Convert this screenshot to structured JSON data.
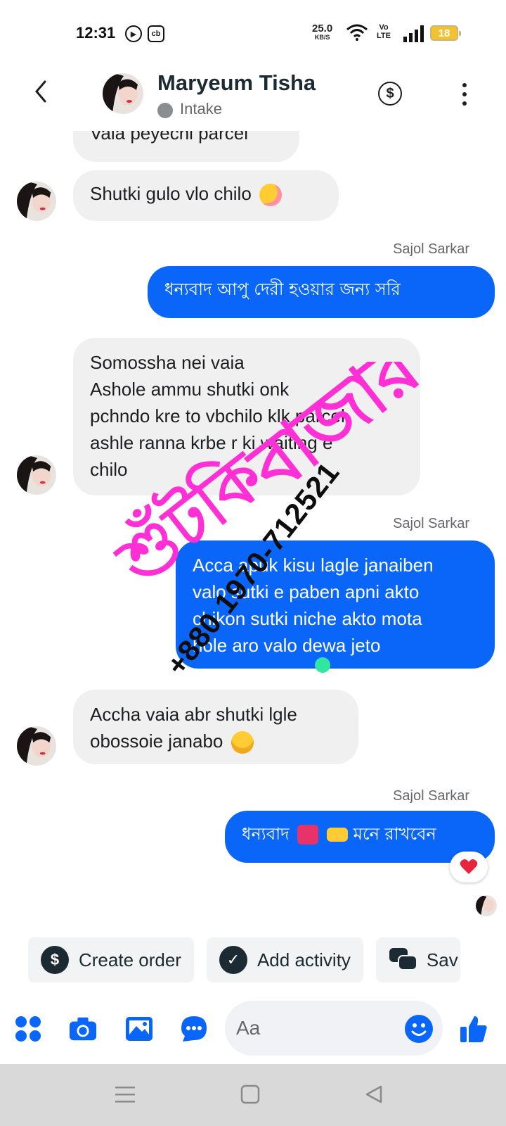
{
  "status_bar": {
    "time": "12:31",
    "net_speed": "25.0",
    "net_unit": "KB/S",
    "volte_top": "Vo",
    "volte_bottom": "LTE",
    "battery": "18"
  },
  "header": {
    "name": "Maryeum Tisha",
    "status": "Intake",
    "dollar_symbol": "$"
  },
  "messages": [
    {
      "from": "contact",
      "text": "Vaia peyechi parcel"
    },
    {
      "from": "contact",
      "text": "Shutki gulo vlo chilo",
      "emoji": "smiling-face-with-hearts"
    },
    {
      "from": "me",
      "sender": "Sajol Sarkar",
      "text": "ধন্যবাদ আপু দেরী হওয়ার জন্য সরি"
    },
    {
      "from": "contact",
      "lines": [
        "Somossha nei vaia",
        "Ashole ammu shutki onk",
        "pchndo kre to vbchilo klk parcel",
        "ashle ranna krbe r ki waiting e",
        "chilo"
      ]
    },
    {
      "from": "me",
      "sender": "Sajol Sarkar",
      "lines": [
        "Acca apuk kisu lagle janaiben",
        "valo sutki e paben apni akto",
        "chikon sutki niche akto mota",
        "hole aro valo dewa jeto"
      ]
    },
    {
      "from": "contact",
      "lines": [
        "Accha vaia abr shutki lgle",
        "obossoie janabo"
      ],
      "emoji": "smiling-face"
    },
    {
      "from": "me",
      "sender": "Sajol Sarkar",
      "text_a": "ধন্যবাদ",
      "text_b": "মনে রাখবেন",
      "reaction": "red-heart"
    }
  ],
  "watermark": {
    "brand_line1": "শুঁটকি",
    "brand_line2": "বাজার",
    "phone": "+880 1970-712521",
    "color": "#ff2fd6"
  },
  "quick_actions": [
    {
      "label": "Create order",
      "icon": "$"
    },
    {
      "label": "Add activity",
      "icon": "✓"
    },
    {
      "label": "Sav"
    }
  ],
  "composer": {
    "placeholder": "Aa"
  },
  "colors": {
    "accent": "#0a66f8",
    "incoming_bubble": "#f0f0f0",
    "watermark": "#ff2fd6"
  }
}
